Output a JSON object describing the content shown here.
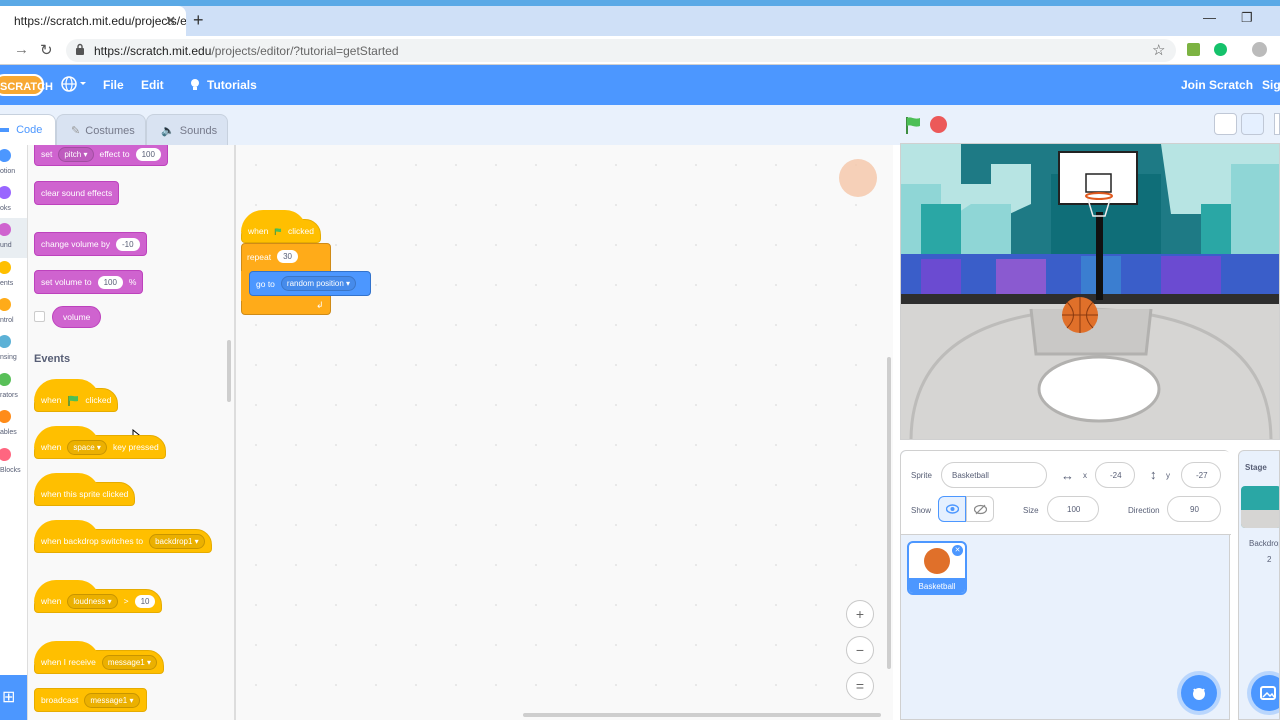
{
  "browser": {
    "tab_title": "https://scratch.mit.edu/projects/e",
    "url_prefix": "https://scratch.mit.edu",
    "url_rest": "/projects/editor/?tutorial=getStarted"
  },
  "menubar": {
    "logo": "SCRATCH",
    "file": "File",
    "edit": "Edit",
    "tutorials": "Tutorials",
    "join": "Join Scratch",
    "sign_in": "Sign"
  },
  "editor_tabs": {
    "code": "Code",
    "costumes": "Costumes",
    "sounds": "Sounds"
  },
  "categories": [
    "otion",
    "oks",
    "und",
    "ents",
    "ntrol",
    "nsing",
    "rators",
    "ables",
    "Blocks"
  ],
  "palette": {
    "set_effect": {
      "label": "set",
      "dropdown": "pitch",
      "suffix": "effect to",
      "value": "100"
    },
    "clear_effects": "clear sound effects",
    "change_volume": {
      "label": "change volume by",
      "value": "-10"
    },
    "set_volume": {
      "label": "set volume to",
      "value": "100",
      "suffix": "%"
    },
    "volume_reporter": "volume",
    "events_heading": "Events",
    "flag_clicked": {
      "when": "when",
      "clicked": "clicked"
    },
    "key_pressed": {
      "when": "when",
      "key": "space",
      "suffix": "key pressed"
    },
    "sprite_clicked": "when this sprite clicked",
    "backdrop_switches": {
      "label": "when backdrop switches to",
      "dropdown": "backdrop1"
    },
    "loudness": {
      "when": "when",
      "dropdown": "loudness",
      "op": ">",
      "value": "10"
    },
    "receive": {
      "label": "when I receive",
      "dropdown": "message1"
    },
    "broadcast": {
      "label": "broadcast",
      "dropdown": "message1"
    }
  },
  "script": {
    "hat_when": "when",
    "hat_clicked": "clicked",
    "repeat_label": "repeat",
    "repeat_value": "30",
    "goto_label": "go to",
    "goto_dropdown": "random position"
  },
  "sprite_info": {
    "sprite_label": "Sprite",
    "sprite_name": "Basketball",
    "x_label": "x",
    "x_value": "-24",
    "y_label": "y",
    "y_value": "-27",
    "show_label": "Show",
    "size_label": "Size",
    "size_value": "100",
    "direction_label": "Direction",
    "direction_value": "90"
  },
  "sprites": [
    {
      "name": "Basketball"
    }
  ],
  "stage_pane": {
    "title": "Stage",
    "backdrops_label": "Backdrop",
    "backdrops_count": "2"
  },
  "colors": {
    "scratch_blue": "#4c97ff",
    "sound_purple": "#cf63cf",
    "events_yellow": "#ffbf00",
    "control_orange": "#ffab19",
    "motion_blue": "#4c97ff"
  }
}
